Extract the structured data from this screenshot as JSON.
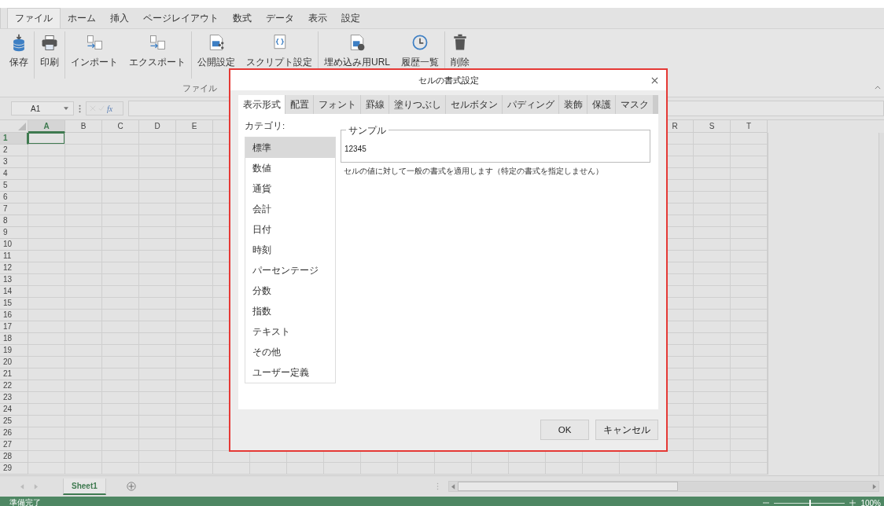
{
  "ribbon_tabs": [
    {
      "label": "ファイル",
      "selected": true
    },
    {
      "label": "ホーム",
      "selected": false
    },
    {
      "label": "挿入",
      "selected": false
    },
    {
      "label": "ページレイアウト",
      "selected": false
    },
    {
      "label": "数式",
      "selected": false
    },
    {
      "label": "データ",
      "selected": false
    },
    {
      "label": "表示",
      "selected": false
    },
    {
      "label": "設定",
      "selected": false
    }
  ],
  "ribbon_groups": [
    [
      {
        "label": "保存",
        "kind": "save"
      }
    ],
    [
      {
        "label": "印刷",
        "kind": "print"
      }
    ],
    [
      {
        "label": "インポート",
        "kind": "import"
      },
      {
        "label": "エクスポート",
        "kind": "export"
      }
    ],
    [
      {
        "label": "公開設定",
        "kind": "publish"
      },
      {
        "label": "スクリプト設定",
        "kind": "script"
      }
    ],
    [
      {
        "label": "埋め込み用URL",
        "kind": "embed"
      },
      {
        "label": "履歴一覧",
        "kind": "history"
      }
    ],
    [
      {
        "label": "削除",
        "kind": "delete"
      }
    ]
  ],
  "ribbon_section_label": "ファイル",
  "formula_bar": {
    "name_box": "A1",
    "fx": "fx"
  },
  "columns": [
    {
      "label": "A",
      "selected": true
    },
    {
      "label": "B",
      "selected": false
    },
    {
      "label": "C",
      "selected": false
    },
    {
      "label": "D",
      "selected": false
    },
    {
      "label": "E",
      "selected": false
    },
    {
      "label": "R",
      "selected": false
    },
    {
      "label": "S",
      "selected": false
    },
    {
      "label": "T",
      "selected": false
    }
  ],
  "rows": [
    {
      "label": "1",
      "selected": true
    },
    {
      "label": "2",
      "selected": false
    },
    {
      "label": "3",
      "selected": false
    },
    {
      "label": "4",
      "selected": false
    },
    {
      "label": "5",
      "selected": false
    },
    {
      "label": "6",
      "selected": false
    },
    {
      "label": "7",
      "selected": false
    },
    {
      "label": "8",
      "selected": false
    },
    {
      "label": "9",
      "selected": false
    },
    {
      "label": "10",
      "selected": false
    },
    {
      "label": "11",
      "selected": false
    },
    {
      "label": "12",
      "selected": false
    },
    {
      "label": "13",
      "selected": false
    },
    {
      "label": "14",
      "selected": false
    },
    {
      "label": "15",
      "selected": false
    },
    {
      "label": "16",
      "selected": false
    },
    {
      "label": "17",
      "selected": false
    },
    {
      "label": "18",
      "selected": false
    },
    {
      "label": "19",
      "selected": false
    },
    {
      "label": "20",
      "selected": false
    },
    {
      "label": "21",
      "selected": false
    },
    {
      "label": "22",
      "selected": false
    },
    {
      "label": "23",
      "selected": false
    },
    {
      "label": "24",
      "selected": false
    },
    {
      "label": "25",
      "selected": false
    },
    {
      "label": "26",
      "selected": false
    },
    {
      "label": "27",
      "selected": false
    },
    {
      "label": "28",
      "selected": false
    },
    {
      "label": "29",
      "selected": false
    }
  ],
  "sheet_tabs": [
    {
      "label": "Sheet1",
      "selected": true
    }
  ],
  "status_bar": {
    "text": "準備完了",
    "zoom": "100%",
    "zoom_level": {
      "level": 0.5
    }
  },
  "dialog": {
    "title": "セルの書式設定",
    "tabs": [
      {
        "label": "表示形式",
        "selected": true
      },
      {
        "label": "配置",
        "selected": false
      },
      {
        "label": "フォント",
        "selected": false
      },
      {
        "label": "罫線",
        "selected": false
      },
      {
        "label": "塗りつぶし",
        "selected": false
      },
      {
        "label": "セルボタン",
        "selected": false
      },
      {
        "label": "パディング",
        "selected": false
      },
      {
        "label": "装飾",
        "selected": false
      },
      {
        "label": "保護",
        "selected": false
      },
      {
        "label": "マスク",
        "selected": false
      }
    ],
    "category_label": "カテゴリ:",
    "categories": [
      {
        "label": "標準",
        "selected": true
      },
      {
        "label": "数値",
        "selected": false
      },
      {
        "label": "通貨",
        "selected": false
      },
      {
        "label": "会計",
        "selected": false
      },
      {
        "label": "日付",
        "selected": false
      },
      {
        "label": "時刻",
        "selected": false
      },
      {
        "label": "パーセンテージ",
        "selected": false
      },
      {
        "label": "分数",
        "selected": false
      },
      {
        "label": "指数",
        "selected": false
      },
      {
        "label": "テキスト",
        "selected": false
      },
      {
        "label": "その他",
        "selected": false
      },
      {
        "label": "ユーザー定義",
        "selected": false
      }
    ],
    "sample_label": "サンプル",
    "sample_value": "12345",
    "description": "セルの値に対して一般の書式を適用します（特定の書式を指定しません）",
    "buttons": [
      "OK",
      "キャンセル"
    ]
  }
}
